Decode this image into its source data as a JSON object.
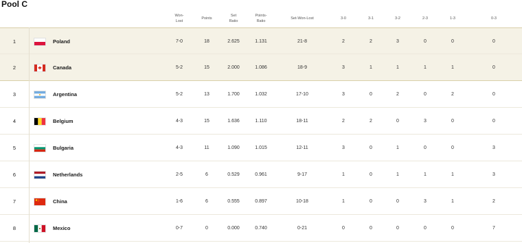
{
  "pool_title": "Pool C",
  "columns": {
    "won_lost": "Won-\nLost",
    "points": "Points",
    "set_ratio": "Set\nRatio",
    "points_ratio": "Points-\nRatio",
    "set_won_lost": "Set-Won-Lost",
    "c30": "3-0",
    "c31": "3-1",
    "c32": "3-2",
    "c23": "2-3",
    "c13": "1-3",
    "c03": "0-3"
  },
  "rows": [
    {
      "rank": "1",
      "team": "Poland",
      "flag": "poland-flag",
      "won_lost": "7-0",
      "points": "18",
      "set_ratio": "2.625",
      "points_ratio": "1.131",
      "set_won_lost": "21-8",
      "c30": "2",
      "c31": "2",
      "c32": "3",
      "c23": "0",
      "c13": "0",
      "c03": "0"
    },
    {
      "rank": "2",
      "team": "Canada",
      "flag": "canada-flag",
      "won_lost": "5-2",
      "points": "15",
      "set_ratio": "2.000",
      "points_ratio": "1.086",
      "set_won_lost": "18-9",
      "c30": "3",
      "c31": "1",
      "c32": "1",
      "c23": "1",
      "c13": "1",
      "c03": "0"
    },
    {
      "rank": "3",
      "team": "Argentina",
      "flag": "argentina-flag",
      "won_lost": "5-2",
      "points": "13",
      "set_ratio": "1.700",
      "points_ratio": "1.032",
      "set_won_lost": "17-10",
      "c30": "3",
      "c31": "0",
      "c32": "2",
      "c23": "0",
      "c13": "2",
      "c03": "0"
    },
    {
      "rank": "4",
      "team": "Belgium",
      "flag": "belgium-flag",
      "won_lost": "4-3",
      "points": "15",
      "set_ratio": "1.636",
      "points_ratio": "1.110",
      "set_won_lost": "18-11",
      "c30": "2",
      "c31": "2",
      "c32": "0",
      "c23": "3",
      "c13": "0",
      "c03": "0"
    },
    {
      "rank": "5",
      "team": "Bulgaria",
      "flag": "bulgaria-flag",
      "won_lost": "4-3",
      "points": "11",
      "set_ratio": "1.090",
      "points_ratio": "1.015",
      "set_won_lost": "12-11",
      "c30": "3",
      "c31": "0",
      "c32": "1",
      "c23": "0",
      "c13": "0",
      "c03": "3"
    },
    {
      "rank": "6",
      "team": "Netherlands",
      "flag": "netherlands-flag",
      "won_lost": "2-5",
      "points": "6",
      "set_ratio": "0.529",
      "points_ratio": "0.961",
      "set_won_lost": "9-17",
      "c30": "1",
      "c31": "0",
      "c32": "1",
      "c23": "1",
      "c13": "1",
      "c03": "3"
    },
    {
      "rank": "7",
      "team": "China",
      "flag": "china-flag",
      "won_lost": "1-6",
      "points": "6",
      "set_ratio": "0.555",
      "points_ratio": "0.897",
      "set_won_lost": "10-18",
      "c30": "1",
      "c31": "0",
      "c32": "0",
      "c23": "3",
      "c13": "1",
      "c03": "2"
    },
    {
      "rank": "8",
      "team": "Mexico",
      "flag": "mexico-flag",
      "won_lost": "0-7",
      "points": "0",
      "set_ratio": "0.000",
      "points_ratio": "0.740",
      "set_won_lost": "0-21",
      "c30": "0",
      "c31": "0",
      "c32": "0",
      "c23": "0",
      "c13": "0",
      "c03": "7"
    }
  ],
  "colors": {
    "qualified_row_bg": "#f5f2e6",
    "qualified_border": "#d9cfa8"
  }
}
